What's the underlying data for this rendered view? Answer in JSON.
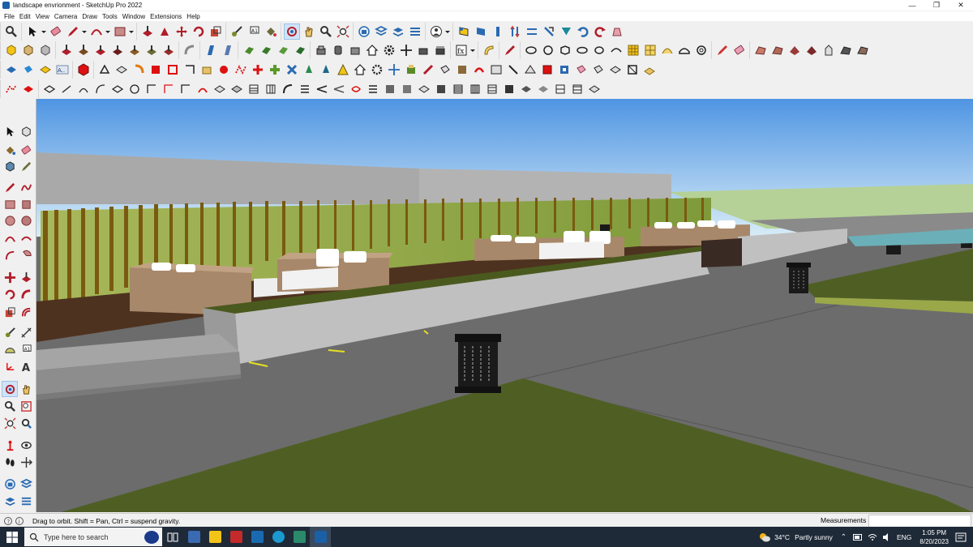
{
  "window": {
    "title": "landscape envrionment - SketchUp Pro 2022",
    "minimize": "—",
    "restore": "❐",
    "close": "✕"
  },
  "menu": [
    "File",
    "Edit",
    "View",
    "Camera",
    "Draw",
    "Tools",
    "Window",
    "Extensions",
    "Help"
  ],
  "status": {
    "hint": "Drag to orbit. Shift = Pan, Ctrl = suspend gravity.",
    "measurements_label": "Measurements",
    "measurements_value": ""
  },
  "taskbar": {
    "search_placeholder": "Type here to search",
    "weather_temp": "34°C",
    "weather_desc": "Partly sunny",
    "language": "ENG",
    "time": "1:05 PM",
    "date": "8/20/2023"
  },
  "active_tool": "orbit-tool",
  "colors": {
    "sky_top": "#4f95e3",
    "sky_bottom": "#d8ecf7",
    "grass": "#4f5f24",
    "road": "#6c6c6c",
    "wall": "#bcbcbc",
    "fence_green": "#8fa64a",
    "fence_brown": "#7a5a10",
    "taskbar": "#1f2a38"
  }
}
